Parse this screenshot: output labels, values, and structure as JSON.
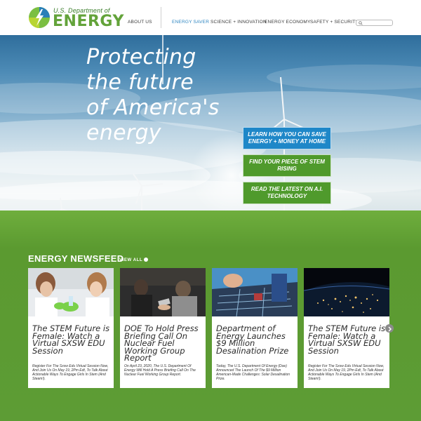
{
  "header": {
    "logo_small": "U.S. Department of",
    "logo_big": "ENERGY",
    "nav": [
      {
        "label": "ABOUT US"
      },
      {
        "label": "ENERGY SAVER"
      },
      {
        "label": "SCIENCE + INNOVATION"
      },
      {
        "label": "ENERGY ECONOMY"
      },
      {
        "label": "SAFETY + SECURITY"
      }
    ],
    "search_icon": "search-icon"
  },
  "hero": {
    "title_lines": [
      "Protecting",
      "the future",
      "of America's",
      "energy"
    ],
    "ctas": [
      {
        "label": "LEARN HOW YOU CAN SAVE ENERGY + MONEY AT HOME",
        "color": "#1e87c8"
      },
      {
        "label": "FIND YOUR PIECE OF STEM RISING",
        "color": "#4f9a2c"
      },
      {
        "label": "READ THE LATEST ON A.I. TECHNOLOGY",
        "color": "#4f9a2c"
      }
    ]
  },
  "newsfeed": {
    "heading": "ENERGY NEWSFEED",
    "view_all": "VIEW ALL",
    "cards": [
      {
        "title": "The STEM Future is Female: Watch a Virtual SXSW EDU Session",
        "desc": "Register For The Sxsw Edu Virtual Session Now, And Join Us On May 19, 2Pm Edt, To Talk About Actionable Ways To Engage Girls In Stem (And Steam!)."
      },
      {
        "title": "DOE To Hold Press Briefing Call On Nuclear Fuel Working Group Report",
        "desc": "On April 23, 2020, The U.S. Department Of Energy Will Hold A Press Briefing Call On The Nuclear Fuel Working Group Report."
      },
      {
        "title": "Department of Energy Launches $9 Million Desalination Prize",
        "desc": "Today, The U.S. Department Of Energy (Doe) Announced The Launch Of The $9 Million American-Made Challenges: Solar Desalination Prize."
      },
      {
        "title": "The STEM Future is Female: Watch a Virtual SXSW EDU Session",
        "desc": "Register For The Sxsw Edu Virtual Session Now, And Join Us On May 19, 2Pm Edt, To Talk About Actionable Ways To Engage Girls In Stem (And Steam!)."
      }
    ],
    "next_icon": "chevron-right-icon"
  },
  "colors": {
    "brand_green": "#63a33a",
    "brand_blue": "#2e86c1",
    "field_green": "#5f9a38"
  }
}
